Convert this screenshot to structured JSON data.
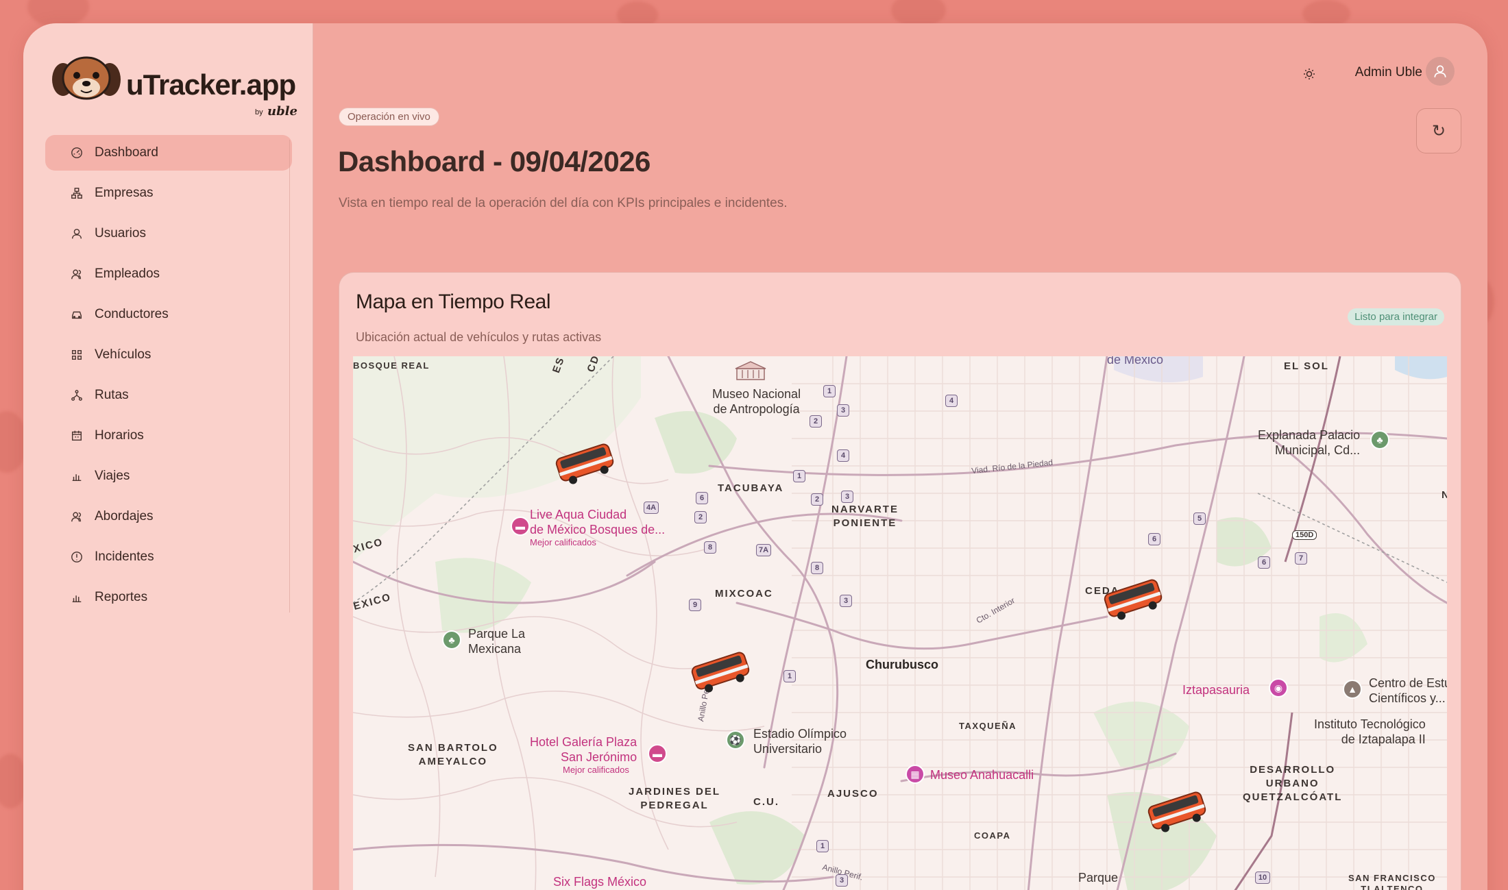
{
  "brand": {
    "name": "uTracker.app",
    "by": "by",
    "maker": "uble"
  },
  "nav": [
    {
      "label": "Dashboard",
      "icon": "dashboard-icon",
      "active": true
    },
    {
      "label": "Empresas",
      "icon": "sitemap-icon"
    },
    {
      "label": "Usuarios",
      "icon": "user-icon"
    },
    {
      "label": "Empleados",
      "icon": "users-icon"
    },
    {
      "label": "Conductores",
      "icon": "car-icon"
    },
    {
      "label": "Vehículos",
      "icon": "grid-icon"
    },
    {
      "label": "Rutas",
      "icon": "route-icon"
    },
    {
      "label": "Horarios",
      "icon": "calendar-icon"
    },
    {
      "label": "Viajes",
      "icon": "bar-chart-icon"
    },
    {
      "label": "Abordajes",
      "icon": "users-icon"
    },
    {
      "label": "Incidentes",
      "icon": "alert-circle-icon"
    },
    {
      "label": "Reportes",
      "icon": "bar-chart-icon"
    }
  ],
  "header": {
    "user_name": "Admin Uble",
    "theme_icon": "sun-icon",
    "refresh_icon": "refresh-icon"
  },
  "page": {
    "badge": "Operación en vivo",
    "title": "Dashboard - 09/04/2026",
    "subtitle": "Vista en tiempo real de la operación del día con KPIs principales e incidentes."
  },
  "map_card": {
    "title": "Mapa en Tiempo Real",
    "subtitle": "Ubicación actual de vehículos y rutas activas",
    "status": "Listo para integrar",
    "labels": {
      "bosque_real": "BOSQUE REAL",
      "es": "ES",
      "cd": "CD",
      "museo": "Museo Nacional\nde Antropología",
      "de_mexico": "de México",
      "el_sol": "EL SOL",
      "explanada": "Explanada Palacio\nMunicipal, Cd...",
      "tacubaya": "TACUBAYA",
      "narvarte": "NARVARTE\nPONIENTE",
      "live_aqua": "Live Aqua Ciudad\nde México Bosques de...",
      "live_aqua_sub": "Mejor calificados",
      "xico1": "XICO",
      "xico2": "EXICO",
      "mixcoac": "MIXCOAC",
      "ceda": "CEDA",
      "parque_la_mexicana": "Parque La\nMexicana",
      "churubusco": "Churubusco",
      "iztapasauria": "Iztapasauria",
      "centro_est": "Centro de Estu\nCientíficos y...",
      "instituto": "Instituto Tecnológico\nde Iztapalapa II",
      "san_bartolo": "SAN BARTOLO\nAMEYALCO",
      "hotel_galeria": "Hotel Galería Plaza\nSan Jerónimo",
      "hotel_sub": "Mejor calificados",
      "estadio": "Estadio Olímpico\nUniversitario",
      "taxquena": "TAXQUEÑA",
      "museo_anahuacalli": "Museo Anahuacalli",
      "desarrollo": "DESARROLLO\nURBANO\nQUETZALCÓATL",
      "jardines": "JARDINES DEL\nPEDREGAL",
      "cu": "C.U.",
      "ajusco": "AJUSCO",
      "coapa": "COAPA",
      "six_flags": "Six Flags México",
      "parque": "Parque",
      "san_francisco": "SAN FRANCISCO\nTLALTENCO",
      "viad_rio": "Viad. Río de la Piedad",
      "cto_interior": "Cto. Interior",
      "anillo_perif": "Anillo Perif.",
      "anillo_perif2": "Anillo Perif.",
      "n": "N",
      "hw_150d": "150D"
    },
    "route_markers": [
      "1",
      "3",
      "2",
      "4",
      "4",
      "1",
      "6",
      "2",
      "3",
      "4A",
      "2",
      "8",
      "7A",
      "8",
      "9",
      "3",
      "5",
      "6",
      "6",
      "7",
      "1",
      "1",
      "3",
      "10"
    ]
  },
  "colors": {
    "accent": "#e9857b",
    "bus": "#e8562a",
    "poi_pink": "#c2327e",
    "poi_green": "#5a8a5a"
  }
}
